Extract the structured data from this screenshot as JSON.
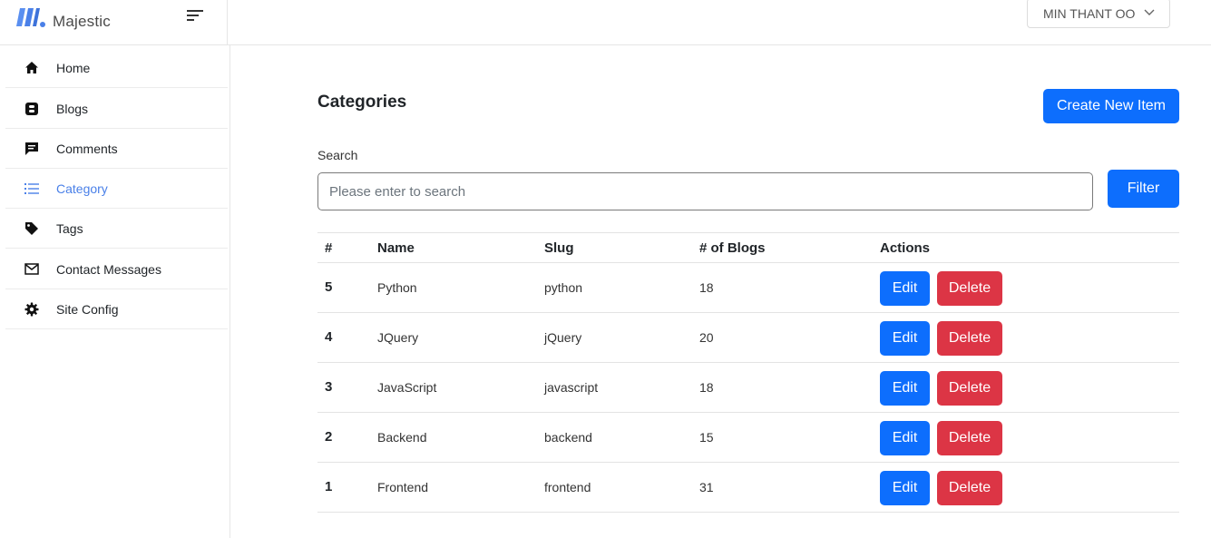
{
  "brand": {
    "name": "Majestic"
  },
  "header": {
    "user_name": "MIN THANT OO"
  },
  "sidebar": {
    "items": [
      {
        "label": "Home",
        "icon": "home-icon",
        "active": false
      },
      {
        "label": "Blogs",
        "icon": "blog-icon",
        "active": false
      },
      {
        "label": "Comments",
        "icon": "comment-icon",
        "active": false
      },
      {
        "label": "Category",
        "icon": "list-icon",
        "active": true
      },
      {
        "label": "Tags",
        "icon": "tag-icon",
        "active": false
      },
      {
        "label": "Contact Messages",
        "icon": "mail-icon",
        "active": false
      },
      {
        "label": "Site Config",
        "icon": "gear-icon",
        "active": false
      }
    ]
  },
  "main": {
    "title": "Categories",
    "create_label": "Create New Item",
    "search": {
      "label": "Search",
      "placeholder": "Please enter to search",
      "value": ""
    },
    "filter_label": "Filter",
    "table": {
      "headers": [
        "#",
        "Name",
        "Slug",
        "# of Blogs",
        "Actions"
      ],
      "rows": [
        {
          "id": "5",
          "name": "Python",
          "slug": "python",
          "blogs": "18"
        },
        {
          "id": "4",
          "name": "JQuery",
          "slug": "jQuery",
          "blogs": "20"
        },
        {
          "id": "3",
          "name": "JavaScript",
          "slug": "javascript",
          "blogs": "18"
        },
        {
          "id": "2",
          "name": "Backend",
          "slug": "backend",
          "blogs": "15"
        },
        {
          "id": "1",
          "name": "Frontend",
          "slug": "frontend",
          "blogs": "31"
        }
      ],
      "edit_label": "Edit",
      "delete_label": "Delete"
    }
  },
  "colors": {
    "primary": "#0d6efd",
    "danger": "#dc3545",
    "active_nav": "#4a80e8",
    "logo": "#4a80e8"
  }
}
